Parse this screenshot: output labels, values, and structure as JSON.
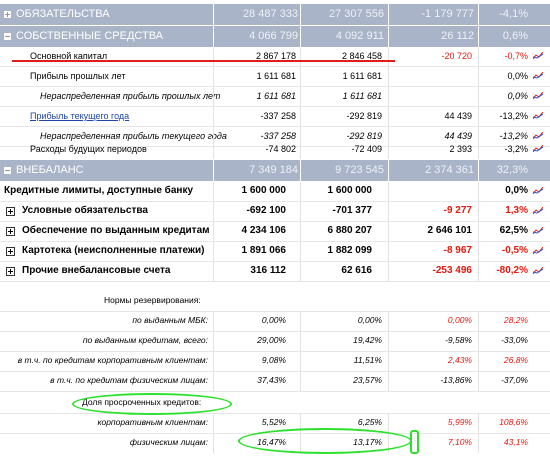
{
  "bands": [
    {
      "title": "ОБЯЗАТЕЛЬСТВА",
      "v1": "28 487 333",
      "v2": "27 307 556",
      "v3": "-1 179 777",
      "v4": "-4,1%",
      "icon": "plus"
    },
    {
      "title": "СОБСТВЕННЫЕ СРЕДСТВА",
      "v1": "4 066 799",
      "v2": "4 092 911",
      "v3": "26 112",
      "v4": "0,6%",
      "icon": "minus"
    },
    {
      "title": "ВНЕБАЛАНС",
      "v1": "7 349 184",
      "v2": "9 723 545",
      "v3": "2 374 361",
      "v4": "32,3%",
      "icon": "minus"
    }
  ],
  "equity_rows": [
    {
      "label": "Основной капитал",
      "v1": "2 867 178",
      "v2": "2 846 458",
      "v3": "-20 720",
      "v4": "-0,7%"
    },
    {
      "label": "Прибыль прошлых лет",
      "v1": "1 611 681",
      "v2": "1 611 681",
      "v3": "",
      "v4": "0,0%"
    },
    {
      "label": "Нераспределенная прибыль прошлых лет",
      "v1": "1 611 681",
      "v2": "1 611 681",
      "v3": "",
      "v4": "0,0%"
    },
    {
      "label": "Прибыль текущего года",
      "v1": "-337 258",
      "v2": "-292 819",
      "v3": "44 439",
      "v4": "-13,2%"
    },
    {
      "label": "Нераспределенная прибыль текущего года",
      "v1": "-337 258",
      "v2": "-292 819",
      "v3": "44 439",
      "v4": "-13,2%"
    },
    {
      "label": "Расходы будущих периодов",
      "v1": "-74 802",
      "v2": "-72 409",
      "v3": "2 393",
      "v4": "-3,2%"
    }
  ],
  "offbalance_rows": [
    {
      "label": "Кредитные лимиты, доступные банку",
      "v1": "1 600 000",
      "v2": "1 600 000",
      "v3": "",
      "v4": "0,0%"
    },
    {
      "label": "Условные обязательства",
      "v1": "-692 100",
      "v2": "-701 377",
      "v3": "-9 277",
      "v4": "1,3%"
    },
    {
      "label": "Обеспечение по выданным кредитам",
      "v1": "4 234 106",
      "v2": "6 880 207",
      "v3": "2 646 101",
      "v4": "62,5%"
    },
    {
      "label": "Картотека (неисполненные платежи)",
      "v1": "1 891 066",
      "v2": "1 882 099",
      "v3": "-8 967",
      "v4": "-0,5%"
    },
    {
      "label": "Прочие внебалансовые счета",
      "v1": "316 112",
      "v2": "62 616",
      "v3": "-253 496",
      "v4": "-80,2%"
    }
  ],
  "norms_title": "Нормы резервирования:",
  "norm_rows": [
    {
      "label": "по выданным МБК:",
      "v1": "0,00%",
      "v2": "0,00%",
      "v3": "0,00%",
      "v4": "28,2%"
    },
    {
      "label": "по выданным кредитам, всего:",
      "v1": "29,00%",
      "v2": "19,42%",
      "v3": "-9,58%",
      "v4": "-33,0%"
    },
    {
      "label": "в т.ч. по кредитам корпоративным клиентам:",
      "v1": "9,08%",
      "v2": "11,51%",
      "v3": "2,43%",
      "v4": "26,8%"
    },
    {
      "label": "в т.ч. по кредитам физическим лицам:",
      "v1": "37,43%",
      "v2": "23,57%",
      "v3": "-13,86%",
      "v4": "-37,0%"
    }
  ],
  "overdue_title": "Доля просроченных кредитов:",
  "overdue_rows": [
    {
      "label": "корпоративным клиентам:",
      "v1": "5,52%",
      "v2": "6,25%",
      "v3": "5,99%",
      "v4": "108,6%"
    },
    {
      "label": "физическим лицам:",
      "v1": "16,47%",
      "v2": "13,17%",
      "v3": "7,10%",
      "v4": "43,1%"
    }
  ],
  "colors": {
    "band": "#a9b4c9",
    "negative": "#e8170c",
    "link": "#1b46a8",
    "highlight": "#2ee02e",
    "underline": "#e21b1b"
  },
  "icons": {
    "band_toggle": "plus-minus-icon",
    "row_chart": "trend-chart-icon",
    "row_expand": "plus-box-icon"
  }
}
